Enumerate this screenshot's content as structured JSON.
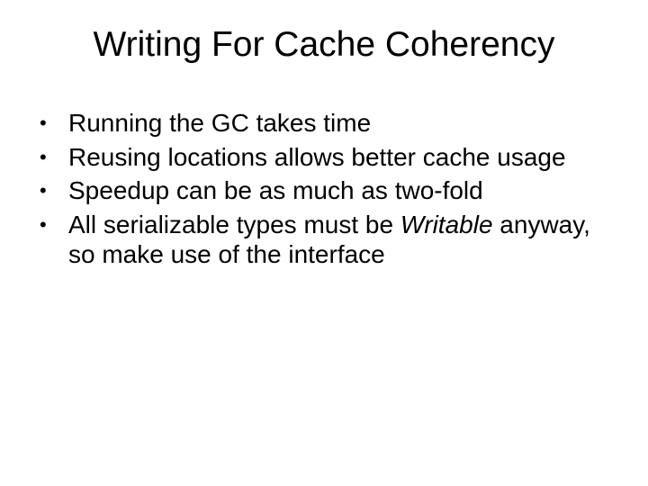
{
  "title": "Writing For Cache Coherency",
  "bullets": [
    {
      "pre": "Running the GC takes time",
      "em": "",
      "post": ""
    },
    {
      "pre": "Reusing locations allows better cache usage",
      "em": "",
      "post": ""
    },
    {
      "pre": "Speedup can be as much as two-fold",
      "em": "",
      "post": ""
    },
    {
      "pre": "All serializable types must be ",
      "em": "Writable",
      "post": " anyway, so make use of the interface"
    }
  ]
}
